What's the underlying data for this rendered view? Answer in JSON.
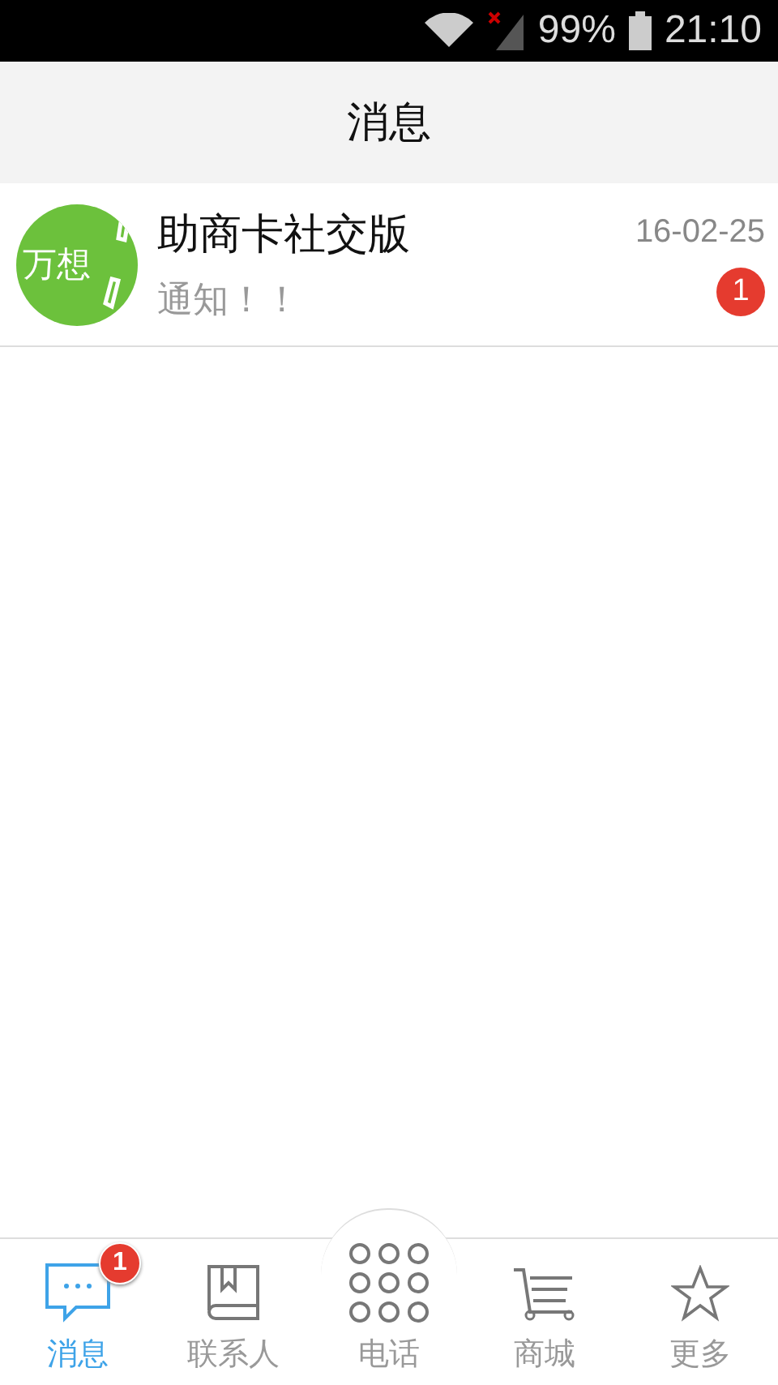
{
  "status_bar": {
    "battery": "99%",
    "time": "21:10"
  },
  "header": {
    "title": "消息"
  },
  "conversations": [
    {
      "avatar_text": "万想",
      "name": "助商卡社交版",
      "preview": "通知！！",
      "date": "16-02-25",
      "unread": "1"
    }
  ],
  "tabs": [
    {
      "kind": "chat",
      "label": "消息",
      "selected": true,
      "badge": "1"
    },
    {
      "kind": "book",
      "label": "联系人",
      "selected": false
    },
    {
      "kind": "dialpad",
      "label": "电话",
      "selected": false
    },
    {
      "kind": "cart",
      "label": "商城",
      "selected": false
    },
    {
      "kind": "star",
      "label": "更多",
      "selected": false
    }
  ]
}
